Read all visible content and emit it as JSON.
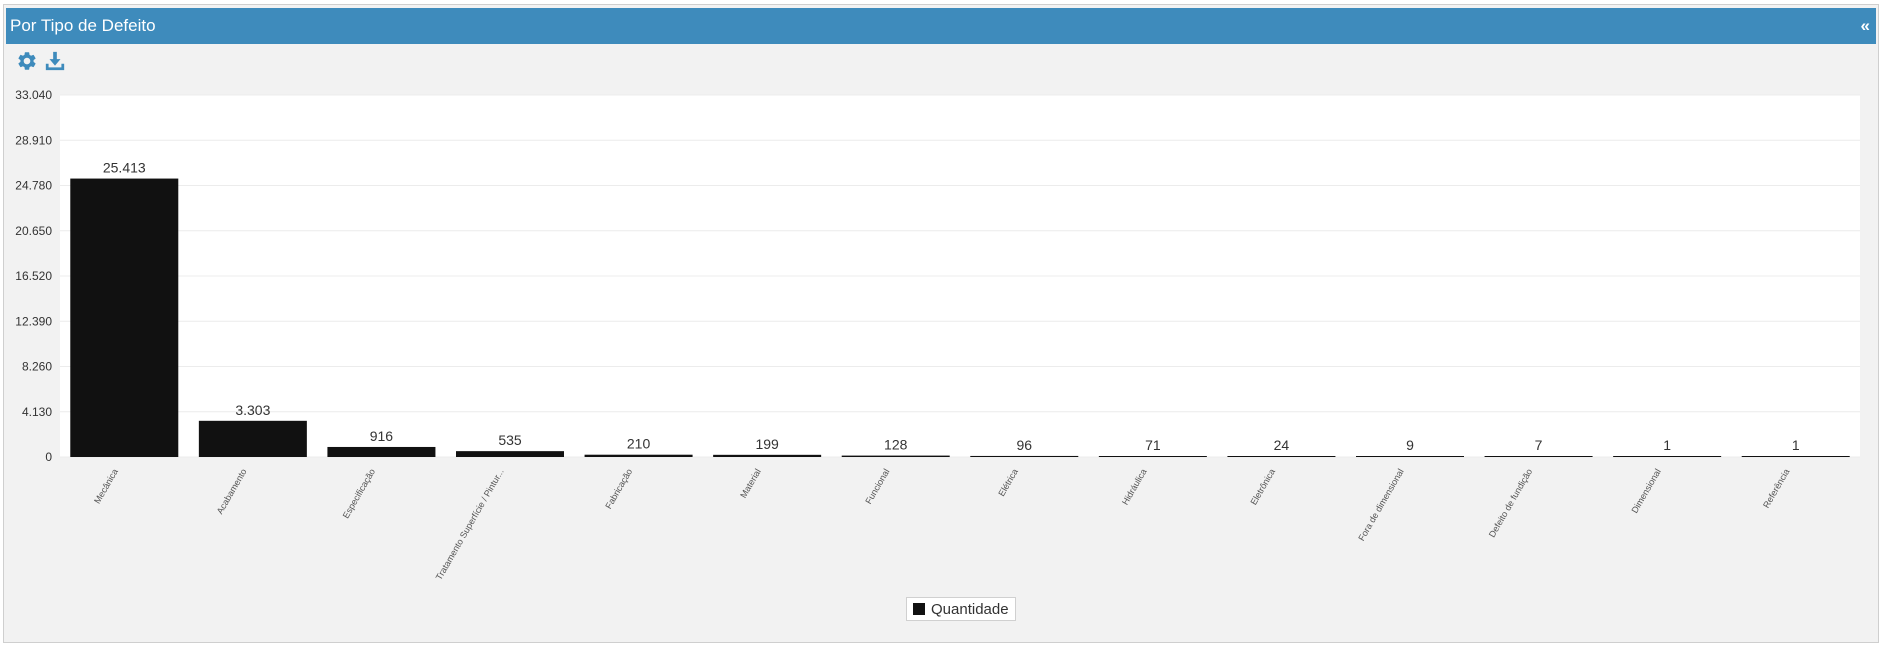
{
  "header": {
    "title": "Por Tipo de Defeito",
    "collapse_label": "«"
  },
  "toolbar": {
    "settings_icon": "gear-icon",
    "download_icon": "download-icon"
  },
  "colors": {
    "header": "#3e8bbc",
    "bar": "#111111",
    "icons": "#3e8bbc",
    "panel": "#f2f2f2"
  },
  "chart_data": {
    "type": "bar",
    "title": "",
    "xlabel": "",
    "ylabel": "",
    "ylim": [
      0,
      33040
    ],
    "yticks": [
      0,
      4130,
      8260,
      12390,
      16520,
      20650,
      24780,
      28910,
      33040
    ],
    "ytick_labels": [
      "0",
      "4.130",
      "8.260",
      "12.390",
      "16.520",
      "20.650",
      "24.780",
      "28.910",
      "33.040"
    ],
    "grid": true,
    "legend": "bottom-center",
    "categories": [
      "Mecânica",
      "Acabamento",
      "Especificação",
      "Tratamento Superfície / Pintur...",
      "Fabricação",
      "Material",
      "Funcional",
      "Elétrica",
      "Hidráulica",
      "Eletrônica",
      "Fora de dimensional",
      "Defeito de fundição",
      "Dimensional",
      "Referência"
    ],
    "series": [
      {
        "name": "Quantidade",
        "values": [
          25413,
          3303,
          916,
          535,
          210,
          199,
          128,
          96,
          71,
          24,
          9,
          7,
          1,
          1
        ],
        "labels": [
          "25.413",
          "3.303",
          "916",
          "535",
          "210",
          "199",
          "128",
          "96",
          "71",
          "24",
          "9",
          "7",
          "1",
          "1"
        ]
      }
    ]
  }
}
